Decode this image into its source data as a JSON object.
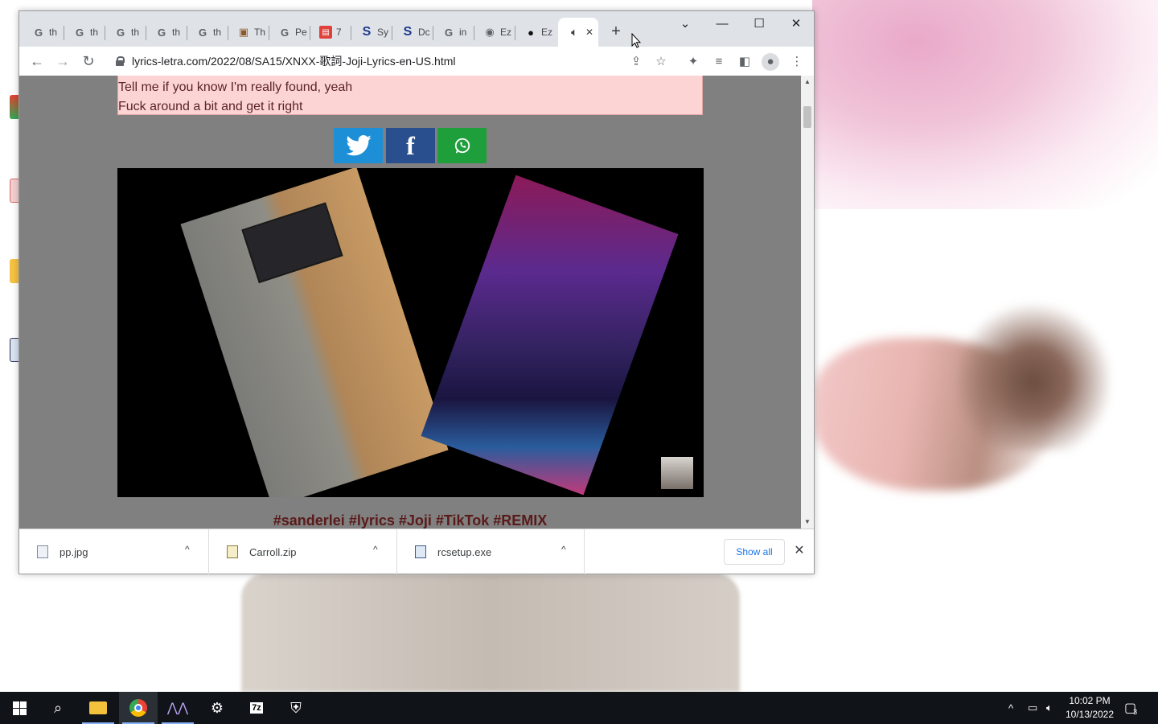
{
  "browser": {
    "tabs": [
      {
        "label": "th",
        "icon": "google-icon"
      },
      {
        "label": "th",
        "icon": "google-icon"
      },
      {
        "label": "th",
        "icon": "google-icon"
      },
      {
        "label": "th",
        "icon": "google-icon"
      },
      {
        "label": "th",
        "icon": "google-icon"
      },
      {
        "label": "Th",
        "icon": "package-icon"
      },
      {
        "label": "Pe",
        "icon": "google-icon"
      },
      {
        "label": "7",
        "icon": "red-app-icon"
      },
      {
        "label": "Sy",
        "icon": "s-logo-icon"
      },
      {
        "label": "Dc",
        "icon": "s-logo-icon"
      },
      {
        "label": "in",
        "icon": "google-icon"
      },
      {
        "label": "Ez",
        "icon": "globe-icon"
      },
      {
        "label": "Ez",
        "icon": "github-icon"
      }
    ],
    "active_tab": {
      "icon": "speaker-icon",
      "close": "✕"
    },
    "new_tab": "+",
    "window_controls": {
      "dropdown": "⌄",
      "minimize": "—",
      "maximize": "☐",
      "close": "✕"
    },
    "url": "lyrics-letra.com/2022/08/SA15/XNXX-歌詞-Joji-Lyrics-en-US.html"
  },
  "page": {
    "lyrics": [
      "Tell me if you know I'm really found, yeah",
      "Fuck around a bit and get it right"
    ],
    "share_buttons": [
      {
        "name": "twitter",
        "color": "#1d8fd6"
      },
      {
        "name": "facebook",
        "color": "#2a4f8f"
      },
      {
        "name": "whatsapp",
        "color": "#1f9e3c"
      }
    ],
    "hashtags": "#sanderlei #lyrics #Joji #TikTok #REMIX"
  },
  "downloads": {
    "items": [
      {
        "name": "pp.jpg"
      },
      {
        "name": "Carroll.zip"
      },
      {
        "name": "rcsetup.exe"
      }
    ],
    "show_all": "Show all"
  },
  "taskbar": {
    "time": "10:02 PM",
    "date": "10/13/2022",
    "notifications": "3"
  }
}
